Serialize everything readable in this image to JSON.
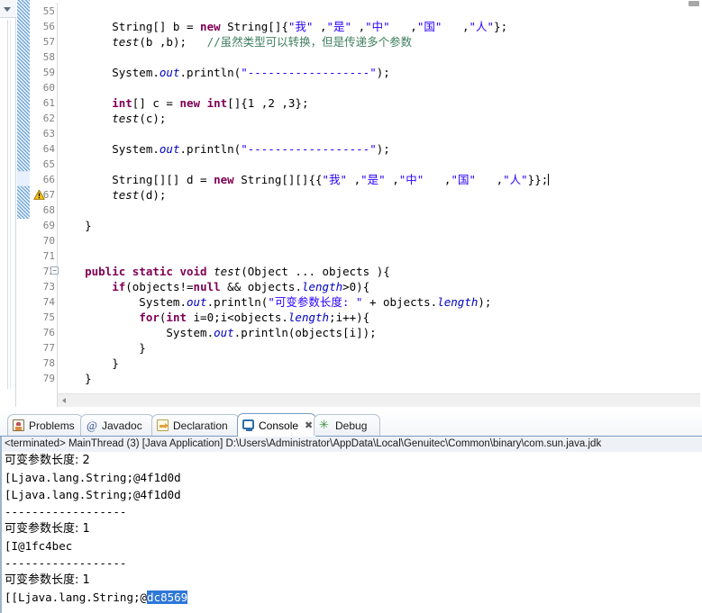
{
  "editor": {
    "first_line": 55,
    "highlighted_line": 66,
    "warning_line": 67,
    "fold_line": 72,
    "caret_line": 66,
    "lines": [
      {
        "n": 55,
        "tokens": []
      },
      {
        "n": 56,
        "tokens": [
          {
            "t": "        String[] b = ",
            "c": "plain"
          },
          {
            "t": "new",
            "c": "kw"
          },
          {
            "t": " String[]{",
            "c": "plain"
          },
          {
            "t": "\"我\"",
            "c": "str"
          },
          {
            "t": " ,",
            "c": "plain"
          },
          {
            "t": "\"是\"",
            "c": "str"
          },
          {
            "t": " ,",
            "c": "plain"
          },
          {
            "t": "\"中\"",
            "c": "str"
          },
          {
            "t": "   ,",
            "c": "plain"
          },
          {
            "t": "\"国\"",
            "c": "str"
          },
          {
            "t": "   ,",
            "c": "plain"
          },
          {
            "t": "\"人\"",
            "c": "str"
          },
          {
            "t": "};",
            "c": "plain"
          }
        ]
      },
      {
        "n": 57,
        "tokens": [
          {
            "t": "        ",
            "c": "plain"
          },
          {
            "t": "test",
            "c": "mth"
          },
          {
            "t": "(b ,b);   ",
            "c": "plain"
          },
          {
            "t": "//虽然类型可以转换，但是传递多个参数",
            "c": "cmt"
          }
        ]
      },
      {
        "n": 58,
        "tokens": []
      },
      {
        "n": 59,
        "tokens": [
          {
            "t": "        System.",
            "c": "plain"
          },
          {
            "t": "out",
            "c": "fld"
          },
          {
            "t": ".println(",
            "c": "plain"
          },
          {
            "t": "\"------------------\"",
            "c": "str"
          },
          {
            "t": ");",
            "c": "plain"
          }
        ]
      },
      {
        "n": 60,
        "tokens": []
      },
      {
        "n": 61,
        "tokens": [
          {
            "t": "        ",
            "c": "plain"
          },
          {
            "t": "int",
            "c": "kw"
          },
          {
            "t": "[] c = ",
            "c": "plain"
          },
          {
            "t": "new",
            "c": "kw"
          },
          {
            "t": " ",
            "c": "plain"
          },
          {
            "t": "int",
            "c": "kw"
          },
          {
            "t": "[]{1 ,2 ,3};",
            "c": "plain"
          }
        ]
      },
      {
        "n": 62,
        "tokens": [
          {
            "t": "        ",
            "c": "plain"
          },
          {
            "t": "test",
            "c": "mth"
          },
          {
            "t": "(c);",
            "c": "plain"
          }
        ]
      },
      {
        "n": 63,
        "tokens": []
      },
      {
        "n": 64,
        "tokens": [
          {
            "t": "        System.",
            "c": "plain"
          },
          {
            "t": "out",
            "c": "fld"
          },
          {
            "t": ".println(",
            "c": "plain"
          },
          {
            "t": "\"------------------\"",
            "c": "str"
          },
          {
            "t": ");",
            "c": "plain"
          }
        ]
      },
      {
        "n": 65,
        "tokens": []
      },
      {
        "n": 66,
        "tokens": [
          {
            "t": "        String[][] d = ",
            "c": "plain"
          },
          {
            "t": "new",
            "c": "kw"
          },
          {
            "t": " String[][]{{",
            "c": "plain"
          },
          {
            "t": "\"我\"",
            "c": "str"
          },
          {
            "t": " ,",
            "c": "plain"
          },
          {
            "t": "\"是\"",
            "c": "str"
          },
          {
            "t": " ,",
            "c": "plain"
          },
          {
            "t": "\"中\"",
            "c": "str"
          },
          {
            "t": "   ,",
            "c": "plain"
          },
          {
            "t": "\"国\"",
            "c": "str"
          },
          {
            "t": "   ,",
            "c": "plain"
          },
          {
            "t": "\"人\"",
            "c": "str"
          },
          {
            "t": "}};",
            "c": "plain"
          }
        ]
      },
      {
        "n": 67,
        "tokens": [
          {
            "t": "        ",
            "c": "plain"
          },
          {
            "t": "test",
            "c": "mth"
          },
          {
            "t": "(d);",
            "c": "plain"
          }
        ]
      },
      {
        "n": 68,
        "tokens": []
      },
      {
        "n": 69,
        "tokens": [
          {
            "t": "    }",
            "c": "plain"
          }
        ]
      },
      {
        "n": 70,
        "tokens": []
      },
      {
        "n": 71,
        "tokens": []
      },
      {
        "n": 72,
        "tokens": [
          {
            "t": "    ",
            "c": "plain"
          },
          {
            "t": "public static void",
            "c": "kw"
          },
          {
            "t": " ",
            "c": "plain"
          },
          {
            "t": "test",
            "c": "mth"
          },
          {
            "t": "(Object ... objects ){",
            "c": "plain"
          }
        ]
      },
      {
        "n": 73,
        "tokens": [
          {
            "t": "        ",
            "c": "plain"
          },
          {
            "t": "if",
            "c": "kw"
          },
          {
            "t": "(objects!=",
            "c": "plain"
          },
          {
            "t": "null",
            "c": "kw"
          },
          {
            "t": " && objects.",
            "c": "plain"
          },
          {
            "t": "length",
            "c": "fld"
          },
          {
            "t": ">0){",
            "c": "plain"
          }
        ]
      },
      {
        "n": 74,
        "tokens": [
          {
            "t": "            System.",
            "c": "plain"
          },
          {
            "t": "out",
            "c": "fld"
          },
          {
            "t": ".println(",
            "c": "plain"
          },
          {
            "t": "\"可变参数长度: \"",
            "c": "str"
          },
          {
            "t": " + objects.",
            "c": "plain"
          },
          {
            "t": "length",
            "c": "fld"
          },
          {
            "t": ");",
            "c": "plain"
          }
        ]
      },
      {
        "n": 75,
        "tokens": [
          {
            "t": "            ",
            "c": "plain"
          },
          {
            "t": "for",
            "c": "kw"
          },
          {
            "t": "(",
            "c": "plain"
          },
          {
            "t": "int",
            "c": "kw"
          },
          {
            "t": " i=0;i<objects.",
            "c": "plain"
          },
          {
            "t": "length",
            "c": "fld"
          },
          {
            "t": ";i++){",
            "c": "plain"
          }
        ]
      },
      {
        "n": 76,
        "tokens": [
          {
            "t": "                System.",
            "c": "plain"
          },
          {
            "t": "out",
            "c": "fld"
          },
          {
            "t": ".println(objects[i]);",
            "c": "plain"
          }
        ]
      },
      {
        "n": 77,
        "tokens": [
          {
            "t": "            }",
            "c": "plain"
          }
        ]
      },
      {
        "n": 78,
        "tokens": [
          {
            "t": "        }",
            "c": "plain"
          }
        ]
      },
      {
        "n": 79,
        "tokens": [
          {
            "t": "    }",
            "c": "plain"
          }
        ]
      }
    ]
  },
  "bottom_panel": {
    "tabs": [
      {
        "label": "Problems",
        "icon": "problems-icon",
        "active": false,
        "closable": false
      },
      {
        "label": "Javadoc",
        "icon": "javadoc-icon",
        "active": false,
        "closable": false
      },
      {
        "label": "Declaration",
        "icon": "declaration-icon",
        "active": false,
        "closable": false
      },
      {
        "label": "Console",
        "icon": "console-icon",
        "active": true,
        "closable": true,
        "close_glyph": "✖"
      },
      {
        "label": "Debug",
        "icon": "debug-icon",
        "active": false,
        "closable": false
      }
    ],
    "console": {
      "header": "<terminated> MainThread (3) [Java Application] D:\\Users\\Administrator\\AppData\\Local\\Genuitec\\Common\\binary\\com.sun.java.jdk",
      "lines": [
        {
          "text": "可变参数长度: 2",
          "cjk": true
        },
        {
          "text": "[Ljava.lang.String;@4f1d0d",
          "cjk": false
        },
        {
          "text": "[Ljava.lang.String;@4f1d0d",
          "cjk": false
        },
        {
          "text": "------------------",
          "cjk": false
        },
        {
          "text": "可变参数长度: 1",
          "cjk": true
        },
        {
          "text": "[I@1fc4bec",
          "cjk": false
        },
        {
          "text": "------------------",
          "cjk": false
        },
        {
          "text": "可变参数长度: 1",
          "cjk": true
        },
        {
          "text": "[[Ljava.lang.String;@",
          "selected": "dc8569",
          "cjk": false
        }
      ]
    }
  },
  "colors": {
    "keyword": "#7f0055",
    "string": "#2a00ff",
    "comment": "#3f7f5f",
    "field": "#0000c0",
    "line_highlight": "#e8f0fd",
    "selection": "#2f78d8",
    "tab_active_border": "#7a9cc6",
    "change_bar": "#5b9bd5"
  }
}
